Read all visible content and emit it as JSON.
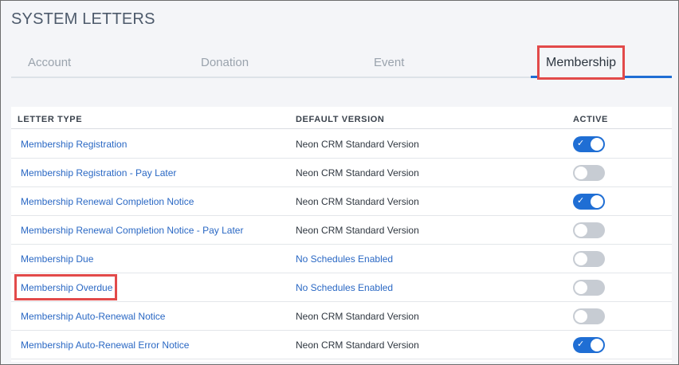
{
  "page": {
    "title": "SYSTEM LETTERS"
  },
  "tabs": [
    {
      "label": "Account",
      "active": false
    },
    {
      "label": "Donation",
      "active": false
    },
    {
      "label": "Event",
      "active": false
    },
    {
      "label": "Membership",
      "active": true
    }
  ],
  "table": {
    "headers": {
      "letter_type": "LETTER TYPE",
      "default_version": "DEFAULT VERSION",
      "active": "ACTIVE"
    },
    "rows": [
      {
        "letter_type": "Membership Registration",
        "default_version": "Neon CRM Standard Version",
        "version_is_link": false,
        "active": true
      },
      {
        "letter_type": "Membership Registration - Pay Later",
        "default_version": "Neon CRM Standard Version",
        "version_is_link": false,
        "active": false
      },
      {
        "letter_type": "Membership Renewal Completion Notice",
        "default_version": "Neon CRM Standard Version",
        "version_is_link": false,
        "active": true
      },
      {
        "letter_type": "Membership Renewal Completion Notice - Pay Later",
        "default_version": "Neon CRM Standard Version",
        "version_is_link": false,
        "active": false
      },
      {
        "letter_type": "Membership Due",
        "default_version": "No Schedules Enabled",
        "version_is_link": true,
        "active": false
      },
      {
        "letter_type": "Membership Overdue",
        "default_version": "No Schedules Enabled",
        "version_is_link": true,
        "active": false
      },
      {
        "letter_type": "Membership Auto-Renewal Notice",
        "default_version": "Neon CRM Standard Version",
        "version_is_link": false,
        "active": false
      },
      {
        "letter_type": "Membership Auto-Renewal Error Notice",
        "default_version": "Neon CRM Standard Version",
        "version_is_link": false,
        "active": true
      }
    ]
  },
  "icons": {
    "toggle_check": "check-icon"
  },
  "colors": {
    "accent": "#1f6ed4",
    "link": "#2a68c4",
    "highlight": "#e24a4a",
    "toggle_off": "#c7ccd3"
  }
}
